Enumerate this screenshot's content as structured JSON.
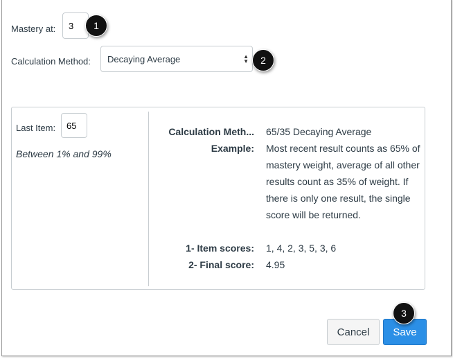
{
  "mastery": {
    "label": "Mastery at:",
    "value": "3"
  },
  "method": {
    "label": "Calculation Method:",
    "value": "Decaying Average"
  },
  "panel": {
    "last_item_label": "Last Item:",
    "last_item_value": "65",
    "range_hint": "Between 1% and 99%",
    "rows": [
      {
        "key": "Calculation Meth...",
        "value": "65/35 Decaying Average"
      },
      {
        "key": "Example:",
        "value": "Most recent result counts as 65% of mastery weight, average of all other results count as 35% of weight. If there is only one result, the single score will be returned."
      },
      {
        "key": "1- Item scores:",
        "value": "1, 4, 2, 3, 5, 3, 6"
      },
      {
        "key": "2- Final score:",
        "value": "4.95"
      }
    ]
  },
  "buttons": {
    "cancel": "Cancel",
    "save": "Save"
  },
  "badges": [
    "1",
    "2",
    "3"
  ],
  "colors": {
    "primary": "#2b8fe6",
    "badge": "#111111"
  }
}
